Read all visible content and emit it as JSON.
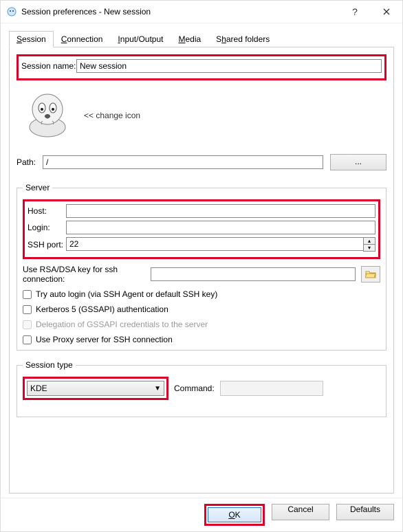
{
  "window": {
    "title": "Session preferences - New session"
  },
  "tabs": {
    "session": "Session",
    "connection": "Connection",
    "io": "Input/Output",
    "media": "Media",
    "shared": "Shared folders"
  },
  "session_name": {
    "label": "Session name:",
    "value": "New session"
  },
  "change_icon": "<< change icon",
  "path": {
    "label": "Path:",
    "value": "/",
    "browse": "..."
  },
  "server": {
    "legend": "Server",
    "host_label": "Host:",
    "host_value": "",
    "login_label": "Login:",
    "login_value": "",
    "ssh_label": "SSH port:",
    "ssh_value": "22",
    "rsa_label": "Use RSA/DSA key for ssh connection:",
    "rsa_value": "",
    "try_auto": "Try auto login (via SSH Agent or default SSH key)",
    "kerberos": "Kerberos 5 (GSSAPI) authentication",
    "delegation": "Delegation of GSSAPI credentials to the server",
    "proxy": "Use Proxy server for SSH connection"
  },
  "session_type": {
    "legend": "Session type",
    "value": "KDE",
    "command_label": "Command:",
    "command_value": ""
  },
  "buttons": {
    "ok": "OK",
    "cancel": "Cancel",
    "defaults": "Defaults"
  }
}
